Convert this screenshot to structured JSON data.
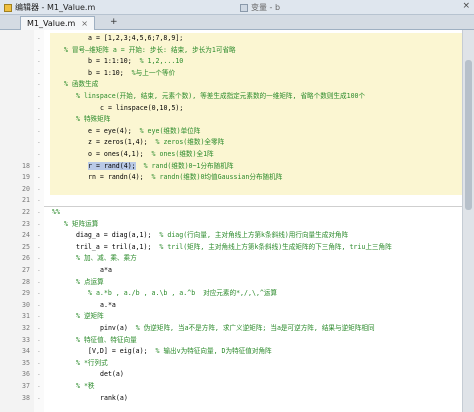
{
  "window": {
    "title": "编辑器 - M1_Value.m",
    "other_panel": "变量 - b",
    "close_glyph": "×"
  },
  "tabs": [
    {
      "label": "M1_Value.m",
      "close": "×"
    }
  ],
  "tab_add": "+",
  "lines": [
    {
      "n": "",
      "text": "a = [1,2,3;4,5,6;7,8,9];",
      "cell": true,
      "indent": 3
    },
    {
      "n": "",
      "text": "% 冒号—维矩阵 a = 开始: 步长: 结束, 步长为1可省略",
      "cell": true,
      "indent": 1,
      "comment": true
    },
    {
      "n": "",
      "text": "b = 1:1:10;  % 1,2,...10",
      "cell": true,
      "indent": 3
    },
    {
      "n": "",
      "text": "b = 1:10;  %与上一个等价",
      "cell": true,
      "indent": 3
    },
    {
      "n": "",
      "text": "% 函数生成",
      "cell": true,
      "indent": 1,
      "comment": true
    },
    {
      "n": "",
      "text": "% linspace(开始, 结束, 元素个数), 等差生成指定元素数的一维矩阵, 省略个数则生成100个",
      "cell": true,
      "indent": 2,
      "comment": true
    },
    {
      "n": "",
      "text": "c = linspace(0,10,5);",
      "cell": true,
      "indent": 4
    },
    {
      "n": "",
      "text": "% 特殊矩阵",
      "cell": true,
      "indent": 2,
      "comment": true
    },
    {
      "n": "",
      "text": "e = eye(4);  % eye(维数)单位阵",
      "cell": true,
      "indent": 3
    },
    {
      "n": "",
      "text": "z = zeros(1,4);  % zeros(维数)全零阵",
      "cell": true,
      "indent": 3
    },
    {
      "n": "",
      "text": "o = ones(4,1);  % ones(维数)全1阵",
      "cell": true,
      "indent": 3
    },
    {
      "n": "18",
      "text": "r = rand(4);  % rand(维数)0~1分布随机阵",
      "cell": true,
      "indent": 3,
      "highlight": true
    },
    {
      "n": "19",
      "text": "rn = randn(4);  % randn(维数)0均值Gaussian分布随机阵",
      "cell": true,
      "indent": 3
    },
    {
      "n": "20",
      "text": "",
      "cell": true,
      "indent": 0
    },
    {
      "n": "21",
      "text": "",
      "cell": false,
      "indent": 0,
      "divider": true
    },
    {
      "n": "22",
      "text": "%%",
      "cell": false,
      "indent": 0,
      "comment": true
    },
    {
      "n": "23",
      "text": "% 矩阵运算",
      "cell": false,
      "indent": 1,
      "comment": true
    },
    {
      "n": "24",
      "text": "diag_a = diag(a,1);  % diag(行向量, 主对角线上方第k条斜线)用行向量生成对角阵",
      "cell": false,
      "indent": 2
    },
    {
      "n": "25",
      "text": "tril_a = tril(a,1);  % tril(矩阵, 主对角线上方第k条斜线)生成矩阵的下三角阵, triu上三角阵",
      "cell": false,
      "indent": 2
    },
    {
      "n": "26",
      "text": "% 加、减、乘、乘方",
      "cell": false,
      "indent": 2,
      "comment": true
    },
    {
      "n": "27",
      "text": "a*a",
      "cell": false,
      "indent": 4
    },
    {
      "n": "28",
      "text": "% 点运算",
      "cell": false,
      "indent": 2,
      "comment": true
    },
    {
      "n": "29",
      "text": "% a.*b , a./b , a.\\b , a.^b  对应元素的*,/,\\,^运算",
      "cell": false,
      "indent": 3,
      "comment": true
    },
    {
      "n": "30",
      "text": "a.*a",
      "cell": false,
      "indent": 4
    },
    {
      "n": "31",
      "text": "% 逆矩阵",
      "cell": false,
      "indent": 2,
      "comment": true
    },
    {
      "n": "32",
      "text": "pinv(a)  % 伪逆矩阵, 当a不是方阵, 求广义逆矩阵; 当a是可逆方阵, 结果与逆矩阵相同",
      "cell": false,
      "indent": 4
    },
    {
      "n": "33",
      "text": "% 特征值、特征向量",
      "cell": false,
      "indent": 2,
      "comment": true
    },
    {
      "n": "34",
      "text": "[V,D] = eig(a);  % 输出v为特征向量, D为特征值对角阵",
      "cell": false,
      "indent": 3
    },
    {
      "n": "35",
      "text": "% *行列式",
      "cell": false,
      "indent": 2,
      "comment": true
    },
    {
      "n": "36",
      "text": "det(a)",
      "cell": false,
      "indent": 4
    },
    {
      "n": "37",
      "text": "% *秩",
      "cell": false,
      "indent": 2,
      "comment": true
    },
    {
      "n": "38",
      "text": "rank(a)",
      "cell": false,
      "indent": 4
    }
  ]
}
